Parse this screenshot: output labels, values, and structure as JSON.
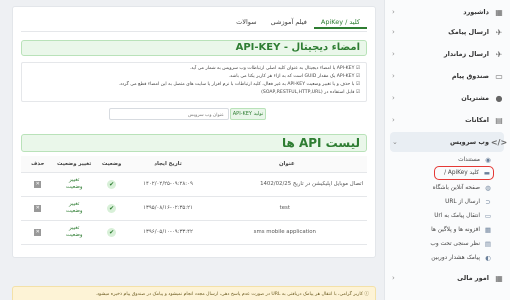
{
  "sidebar": {
    "items": [
      {
        "label": "داشبورد",
        "icon": "dashboard-icon"
      },
      {
        "label": "ارسال پیامک",
        "icon": "send-sms-icon"
      },
      {
        "label": "ارسال زماندار",
        "icon": "scheduled-send-icon"
      },
      {
        "label": "صندوق پیام",
        "icon": "inbox-icon"
      },
      {
        "label": "مشتریان",
        "icon": "customers-icon"
      },
      {
        "label": "امکانات",
        "icon": "features-icon"
      },
      {
        "label": "وب سرویس",
        "icon": "web-service-icon"
      }
    ],
    "sub_items": [
      {
        "label": "مستندات"
      },
      {
        "label": "کلید ApiKey / "
      },
      {
        "label": "صفحه آنلاین باشگاه"
      },
      {
        "label": "ارسال از URL"
      },
      {
        "label": "انتقال پیامک به Url"
      },
      {
        "label": "افزونه ها و پلاگین ها"
      },
      {
        "label": "نظر سنجی تحت وب"
      },
      {
        "label": "پیامک هشدار دوربین"
      }
    ],
    "bottom_item": {
      "label": "امور مالی"
    }
  },
  "tabs": [
    "کلید / ApiKey",
    "فیلم آموزشی",
    "سوالات"
  ],
  "section1_title": "امضاء دیجیتال - API-KEY",
  "info_lines": [
    "API-KEY یا امضاء دیجیتال به عنوان کلید اصلی ارتباطات وب سرویس به شمار می آید.",
    "API-KEY یک مقدار GUID است که به ازاء هر کاربر یکتا می باشد.",
    "با حذف و یا تغییر وضعیت API-KEY به غیر فعال، کلیه ارتباطات با نرم افزار یا سایت های متصل به این امضاء قطع می گردد.",
    "قابل استفاده در (SOAP,RESTFUL,HTTP,URL)"
  ],
  "key_input_placeholder": "عنوان وب سرویس",
  "generate_button": "تولید API-KEY",
  "section2_title": "لیست API ها",
  "table": {
    "headers": [
      "عنوان",
      "تاریخ ایجاد",
      "وضعیت",
      "تغییر وضعیت",
      "حذف"
    ],
    "rows": [
      {
        "title": "اتصال موبایل اپلیکیشن در تاریخ 1402/02/25",
        "date": "۱۴۰۲/۰۲/۲۵-۰۹:۲۸:۰۹",
        "status_action": [
          "تغییر",
          "وضعیت"
        ]
      },
      {
        "title": "test",
        "date": "۱۳۹۵/۰۸/۱۶-۰۲:۳۵:۲۱",
        "status_action": [
          "تغییر",
          "وضعیت"
        ]
      },
      {
        "title": "sms mobile application",
        "date": "۱۳۹۶/۰۵/۱۰-۰۹:۳۳:۴۲",
        "status_action": [
          "تغییر",
          "وضعیت"
        ]
      }
    ]
  },
  "footer_alert": "کاربر گرامی، با انتقال هر پیامک دریافتی به URL در صورت عدم پاسخ دهی، ارسال مجدد انجام نمیشود و پیامک در صندوق پیام ذخیره میشود."
}
